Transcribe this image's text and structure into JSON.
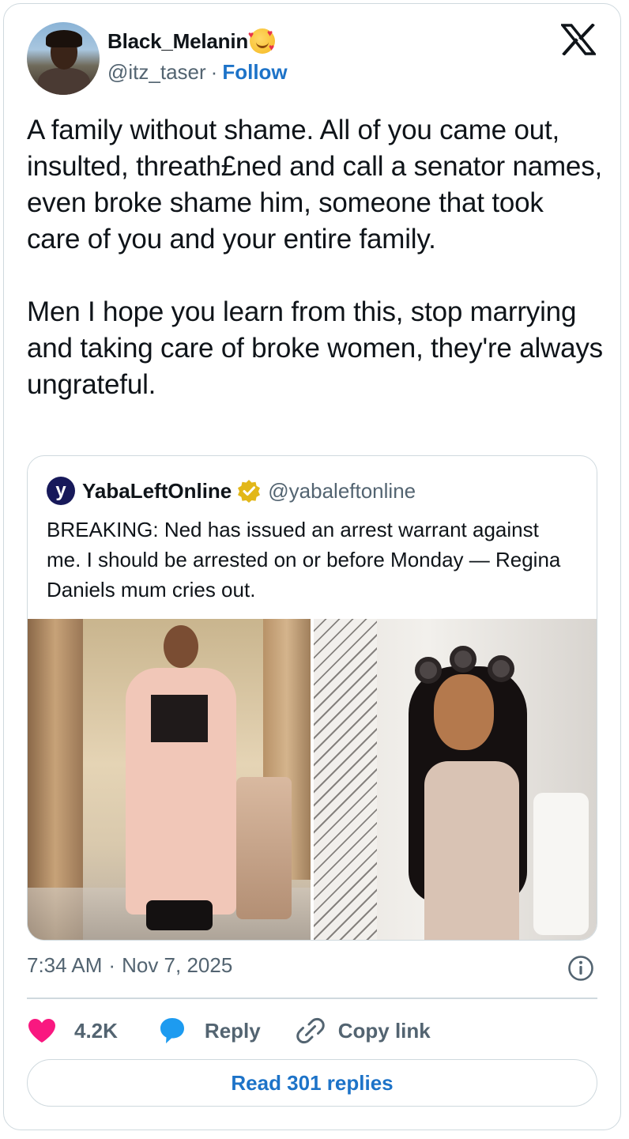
{
  "author": {
    "display_name": "Black_Melanin",
    "handle": "@itz_taser",
    "separator": "·",
    "follow_label": "Follow"
  },
  "tweet": {
    "paragraph1": "A family without shame. All of you came out, insulted, threath£ned and call a senator names, even broke shame him, someone that took care of you and your entire family.",
    "paragraph2": "Men I hope you learn from this, stop marrying and taking care of broke women, they're always ungrateful."
  },
  "quoted_tweet": {
    "logo_letter": "y",
    "display_name": "YabaLeftOnline",
    "handle": "@yabaleftonline",
    "text": "BREAKING: Ned has issued an arrest warrant against me. I should be arrested on or before Monday — Regina Daniels mum cries out."
  },
  "meta": {
    "time": "7:34 AM",
    "separator": "·",
    "date": "Nov 7, 2025"
  },
  "actions": {
    "likes": "4.2K",
    "reply_label": "Reply",
    "copy_link_label": "Copy link"
  },
  "read_replies_label": "Read 301 replies",
  "colors": {
    "accent": "#1d73c8",
    "heart": "#f91880",
    "reply_bubble": "#1d9bf0",
    "verified_gold": "#e2b719",
    "secondary_text": "#536471",
    "border": "#cfd9de"
  },
  "icons": {
    "brand": "x-logo-icon",
    "info": "info-icon",
    "like": "heart-icon",
    "reply": "reply-bubble-icon",
    "copy": "link-icon",
    "verified": "verified-badge-icon"
  }
}
